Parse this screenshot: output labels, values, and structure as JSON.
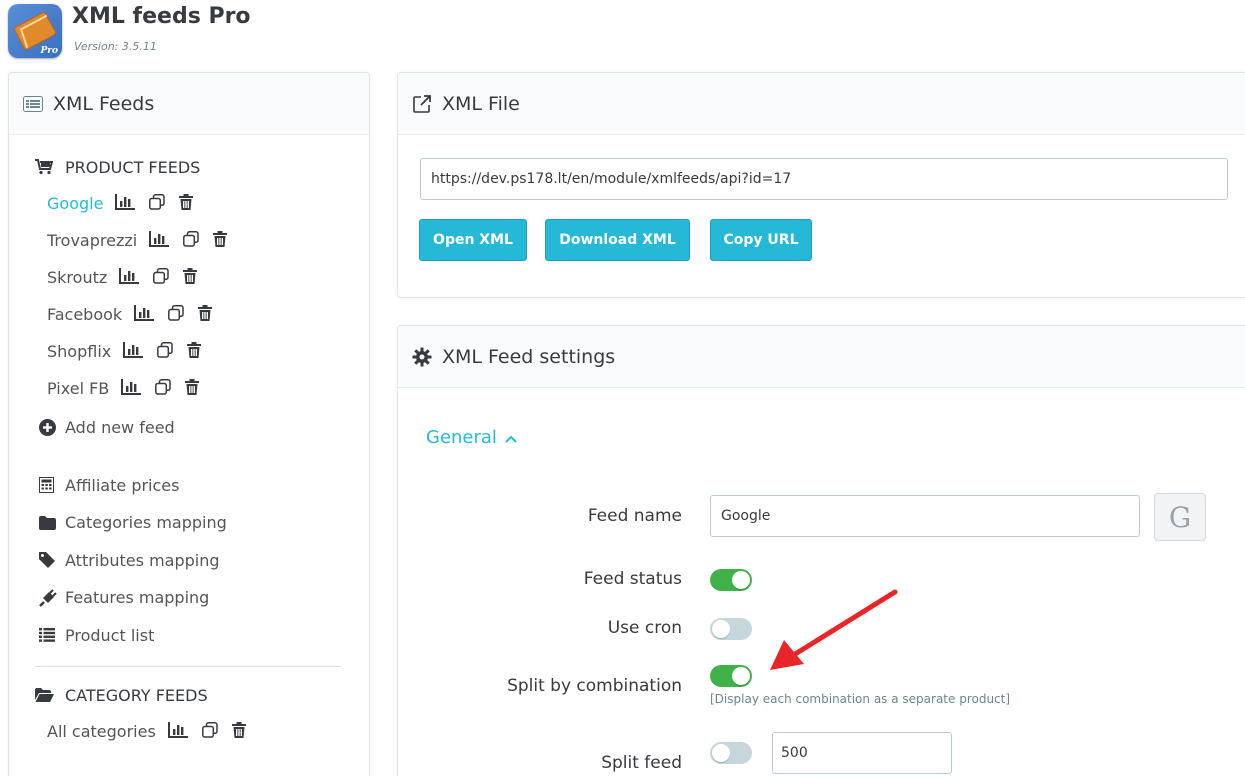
{
  "app": {
    "title": "XML feeds Pro",
    "version": "Version: 3.5.11",
    "logo_text": "Pro"
  },
  "sidebar": {
    "title": "XML Feeds",
    "product_section": "PRODUCT FEEDS",
    "product_feeds": [
      {
        "label": "Google",
        "active": true
      },
      {
        "label": "Trovaprezzi"
      },
      {
        "label": "Skroutz"
      },
      {
        "label": "Facebook"
      },
      {
        "label": "Shopflix"
      },
      {
        "label": "Pixel FB"
      }
    ],
    "add_feed": "Add new feed",
    "menu": [
      {
        "label": "Affiliate prices",
        "icon": "calculator-icon"
      },
      {
        "label": "Categories mapping",
        "icon": "folder-icon"
      },
      {
        "label": "Attributes mapping",
        "icon": "tag-icon"
      },
      {
        "label": "Features mapping",
        "icon": "plug-icon"
      },
      {
        "label": "Product list",
        "icon": "list-icon"
      }
    ],
    "category_section": "CATEGORY FEEDS",
    "category_feeds": [
      {
        "label": "All categories"
      }
    ]
  },
  "xml_file": {
    "title": "XML File",
    "url": "https://dev.ps178.lt/en/module/xmlfeeds/api?id=17",
    "buttons": {
      "open": "Open XML",
      "download": "Download XML",
      "copy": "Copy URL"
    }
  },
  "settings": {
    "title": "XML Feed settings",
    "general": "General",
    "feed_name_label": "Feed name",
    "feed_name": "Google",
    "google_badge": "G",
    "feed_status_label": "Feed status",
    "feed_status": true,
    "use_cron_label": "Use cron",
    "use_cron": false,
    "split_combination_label": "Split by combination",
    "split_combination": true,
    "split_combination_hint": "[Display each combination as a separate product]",
    "split_feed_label": "Split feed",
    "split_feed": false,
    "split_feed_value": "500"
  },
  "colors": {
    "accent": "#25b9d7",
    "toggle_on": "#3fb349",
    "toggle_off": "#c5d6dc",
    "arrow": "#e8262a"
  }
}
